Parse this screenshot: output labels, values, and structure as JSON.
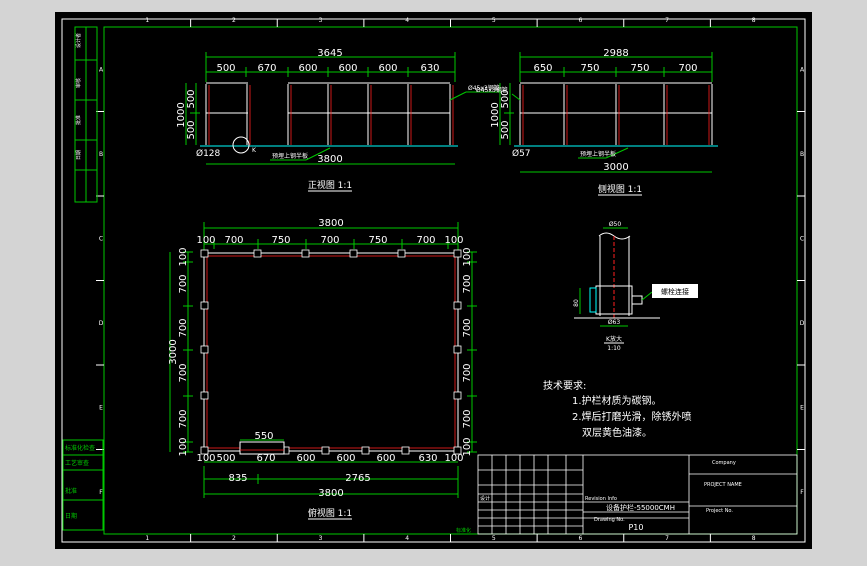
{
  "colors": {
    "viewport_bg": "#d4d4d4",
    "canvas": "#000000",
    "frame": "#ffffff",
    "border": "#00c800",
    "dim_line": "#00c800",
    "dim_text": "#ffffff",
    "member": "#ffffff",
    "member_accent": "#ff2020",
    "base": "#00ffff",
    "table_text": "#ffffff"
  },
  "border": {
    "col_labels": [
      "1",
      "2",
      "3",
      "4",
      "5",
      "6",
      "7",
      "8"
    ],
    "row_labels": [
      "A",
      "B",
      "C",
      "D",
      "E",
      "F"
    ],
    "side_labels": [
      "设计者",
      "审核",
      "批准",
      "日期"
    ],
    "left_boxes": [
      "标准化检查",
      "工艺审查",
      "批准",
      "日期"
    ]
  },
  "front_view": {
    "title": "正视图 1:1",
    "total": "3645",
    "segments": [
      "500",
      "670",
      "600",
      "600",
      "600",
      "630"
    ],
    "heights": [
      "1000",
      "500",
      "500"
    ],
    "diameter": "Ø128",
    "annotation": "Ø45x3钢管",
    "base_note": "预埋上钢半板",
    "base_total": "3800"
  },
  "side_view": {
    "title": "侧视图 1:1",
    "total": "2988",
    "segments": [
      "650",
      "750",
      "750",
      "700"
    ],
    "heights": [
      "1000",
      "500",
      "500"
    ],
    "diameter": "Ø57",
    "annotation": "Ø45x3钢管",
    "base_note": "预埋上钢半板",
    "base_total": "3000"
  },
  "detail": {
    "title": "K放大",
    "scale": "1:10",
    "top_dim": "Ø50",
    "bottom_dim": "Ø63",
    "side_dim": "80",
    "callout": "螺栓连接"
  },
  "plan_view": {
    "title": "俯视图 1:1",
    "top_total": "3800",
    "top_segments": [
      "100",
      "700",
      "750",
      "700",
      "750",
      "700",
      "100"
    ],
    "left_total": "3000",
    "left_segments": [
      "100",
      "700",
      "700",
      "700",
      "700",
      "100"
    ],
    "right_segments": [
      "100",
      "700",
      "700",
      "700",
      "700",
      "100"
    ],
    "bottom_segments": [
      "100",
      "500",
      "670",
      "600",
      "600",
      "600",
      "630",
      "100"
    ],
    "gate_width": "550",
    "bottom_part1": "835",
    "bottom_part2": "2765",
    "bottom_total": "3800"
  },
  "tech_notes": {
    "heading": "技术要求:",
    "items": [
      "1.护栏材质为碳钢。",
      "2.焊后打磨光滑，除锈外喷",
      "双层黄色油漆。"
    ]
  },
  "title_block": {
    "right_top": "Company",
    "right_mid": "PROJECT NAME",
    "project_no": "Project No.",
    "left_title": "设备护栏-55000CMH",
    "drawing_no": "Drawing No.",
    "page": "P10",
    "tag_a": "Revision Info",
    "tag_b": "设计",
    "tag_c": "标准化"
  }
}
